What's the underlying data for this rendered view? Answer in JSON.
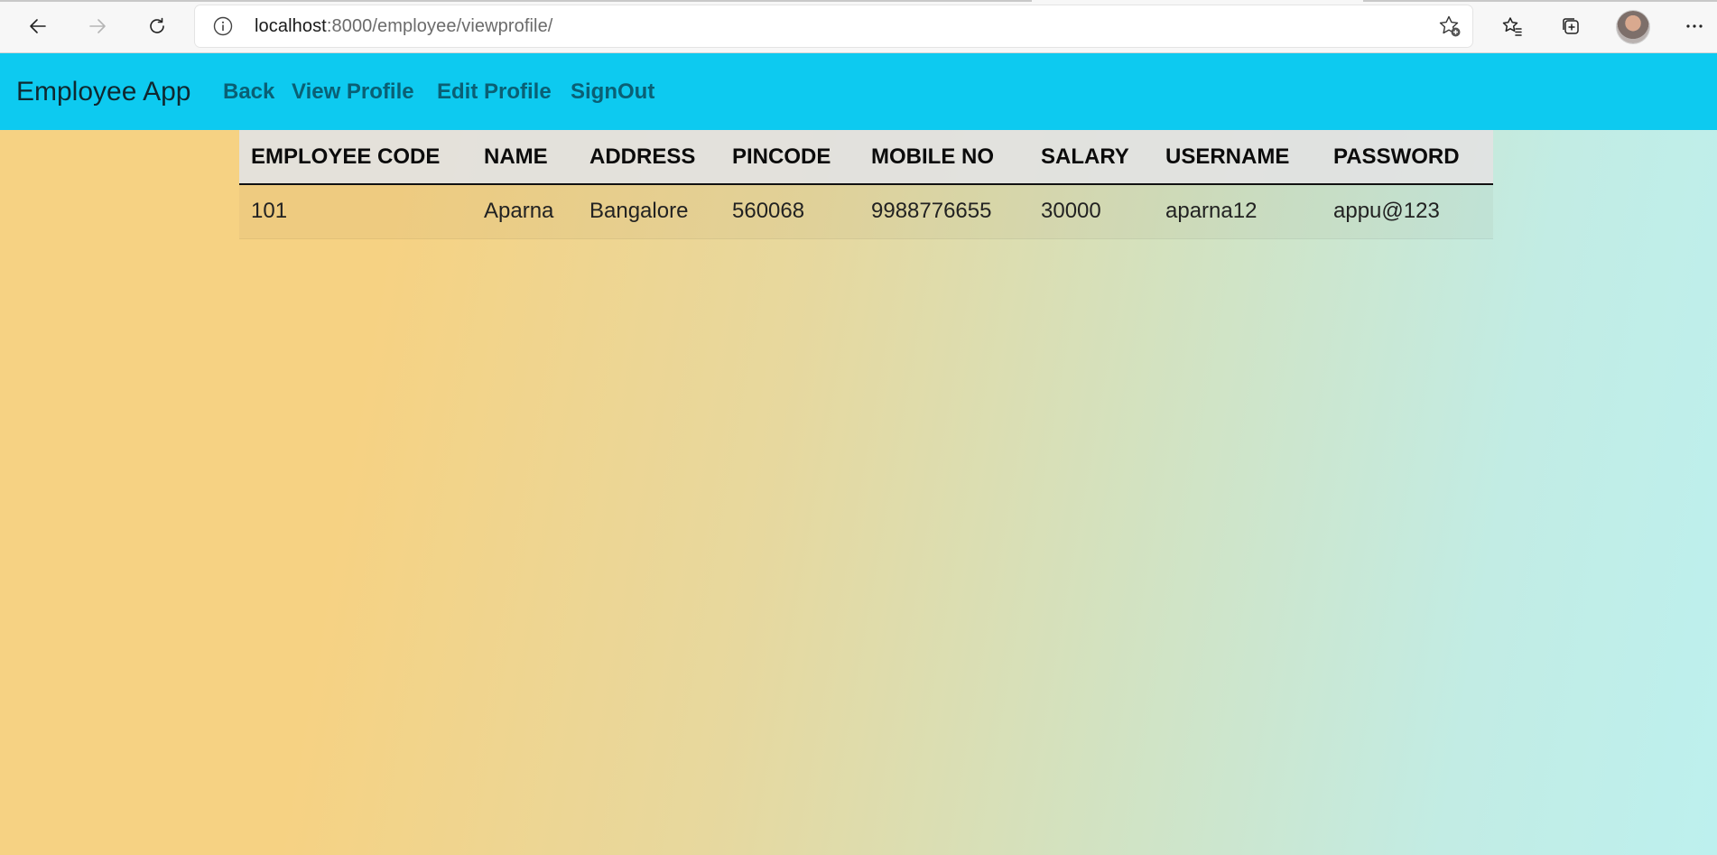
{
  "browser": {
    "url_host": "localhost",
    "url_path": ":8000/employee/viewprofile/",
    "icons": [
      "back-arrow-icon",
      "forward-arrow-icon",
      "refresh-icon",
      "info-icon",
      "add-favorite-icon",
      "favorites-icon",
      "collections-icon",
      "profile-avatar",
      "more-icon"
    ]
  },
  "navbar": {
    "brand": "Employee App",
    "links": [
      {
        "label": "Back"
      },
      {
        "label": "View Profile"
      },
      {
        "label": "Edit Profile"
      },
      {
        "label": "SignOut"
      }
    ],
    "bg_color": "#0dcaf0",
    "link_color": "#0a5f74"
  },
  "table": {
    "headers": [
      "EMPLOYEE CODE",
      "NAME",
      "ADDRESS",
      "PINCODE",
      "MOBILE NO",
      "SALARY",
      "USERNAME",
      "PASSWORD"
    ],
    "rows": [
      [
        "101",
        "Aparna",
        "Bangalore",
        "560068",
        "9988776655",
        "30000",
        "aparna12",
        "appu@123"
      ]
    ]
  },
  "colors": {
    "page_gradient_start": "#f6d283",
    "page_gradient_end": "#bdf0ee"
  }
}
